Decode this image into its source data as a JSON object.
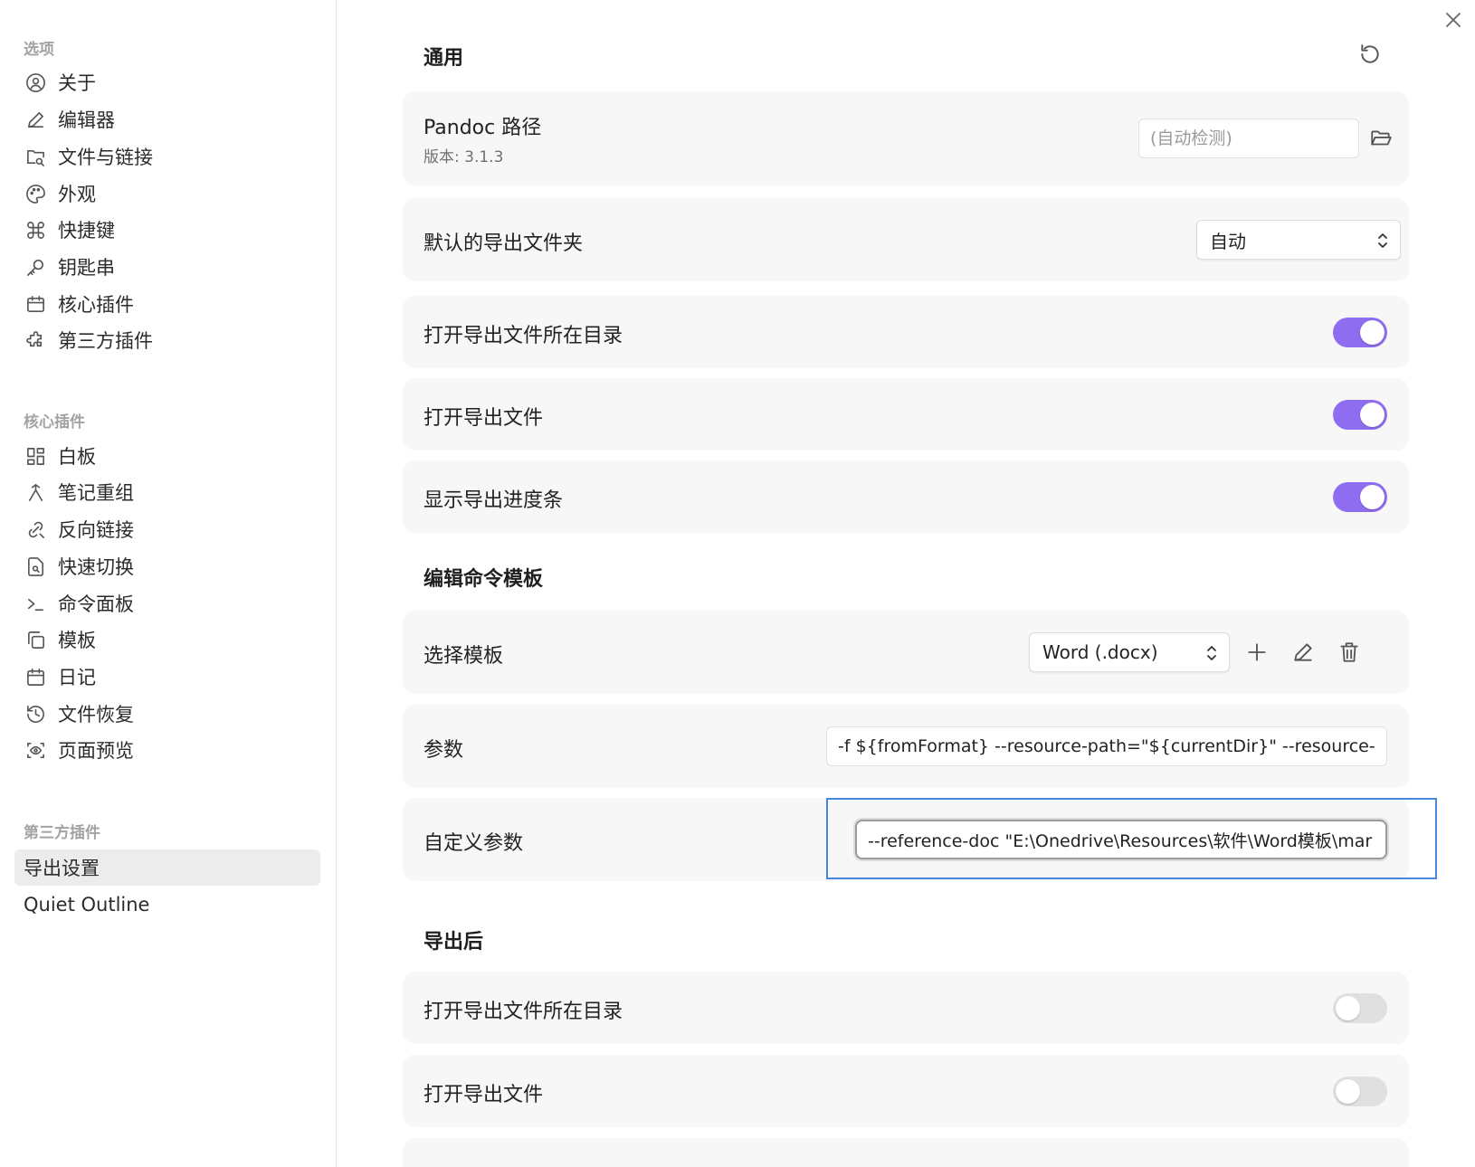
{
  "sidebar": {
    "sections": [
      {
        "heading": "选项",
        "items": [
          {
            "label": "关于",
            "icon": "user-circle-icon"
          },
          {
            "label": "编辑器",
            "icon": "pencil-icon"
          },
          {
            "label": "文件与链接",
            "icon": "folder-link-icon"
          },
          {
            "label": "外观",
            "icon": "palette-icon"
          },
          {
            "label": "快捷键",
            "icon": "command-icon"
          },
          {
            "label": "钥匙串",
            "icon": "key-icon"
          },
          {
            "label": "核心插件",
            "icon": "calendar-box-icon"
          },
          {
            "label": "第三方插件",
            "icon": "puzzle-icon"
          }
        ]
      },
      {
        "heading": "核心插件",
        "items": [
          {
            "label": "白板",
            "icon": "grid-icon"
          },
          {
            "label": "笔记重组",
            "icon": "merge-icon"
          },
          {
            "label": "反向链接",
            "icon": "backlink-icon"
          },
          {
            "label": "快速切换",
            "icon": "file-search-icon"
          },
          {
            "label": "命令面板",
            "icon": "terminal-icon"
          },
          {
            "label": "模板",
            "icon": "copy-icon"
          },
          {
            "label": "日记",
            "icon": "calendar-icon"
          },
          {
            "label": "文件恢复",
            "icon": "history-icon"
          },
          {
            "label": "页面预览",
            "icon": "eye-scan-icon"
          }
        ]
      },
      {
        "heading": "第三方插件",
        "items": [
          {
            "label": "导出设置",
            "active": true
          },
          {
            "label": "Quiet Outline"
          }
        ]
      }
    ]
  },
  "main": {
    "general": {
      "title": "通用",
      "pandoc_label": "Pandoc 路径",
      "pandoc_version": "版本: 3.1.3",
      "pandoc_placeholder": "(自动检测)",
      "default_folder_label": "默认的导出文件夹",
      "default_folder_value": "自动",
      "open_dir_label": "打开导出文件所在目录",
      "open_dir_on": true,
      "open_file_label": "打开导出文件",
      "open_file_on": true,
      "progress_label": "显示导出进度条",
      "progress_on": true
    },
    "template": {
      "title": "编辑命令模板",
      "choose_label": "选择模板",
      "choose_value": "Word (.docx)",
      "args_label": "参数",
      "args_value": "-f ${fromFormat} --resource-path=\"${currentDir}\" --resource-pa",
      "custom_label": "自定义参数",
      "custom_value": "--reference-doc \"E:\\Onedrive\\Resources\\软件\\Word模板\\mar"
    },
    "after": {
      "title": "导出后",
      "open_dir_label": "打开导出文件所在目录",
      "open_dir_on": false,
      "open_file_label": "打开导出文件",
      "open_file_on": false
    }
  },
  "colors": {
    "accent": "#8f6df0",
    "focus": "#4a85de",
    "card": "#f7f7f7"
  }
}
